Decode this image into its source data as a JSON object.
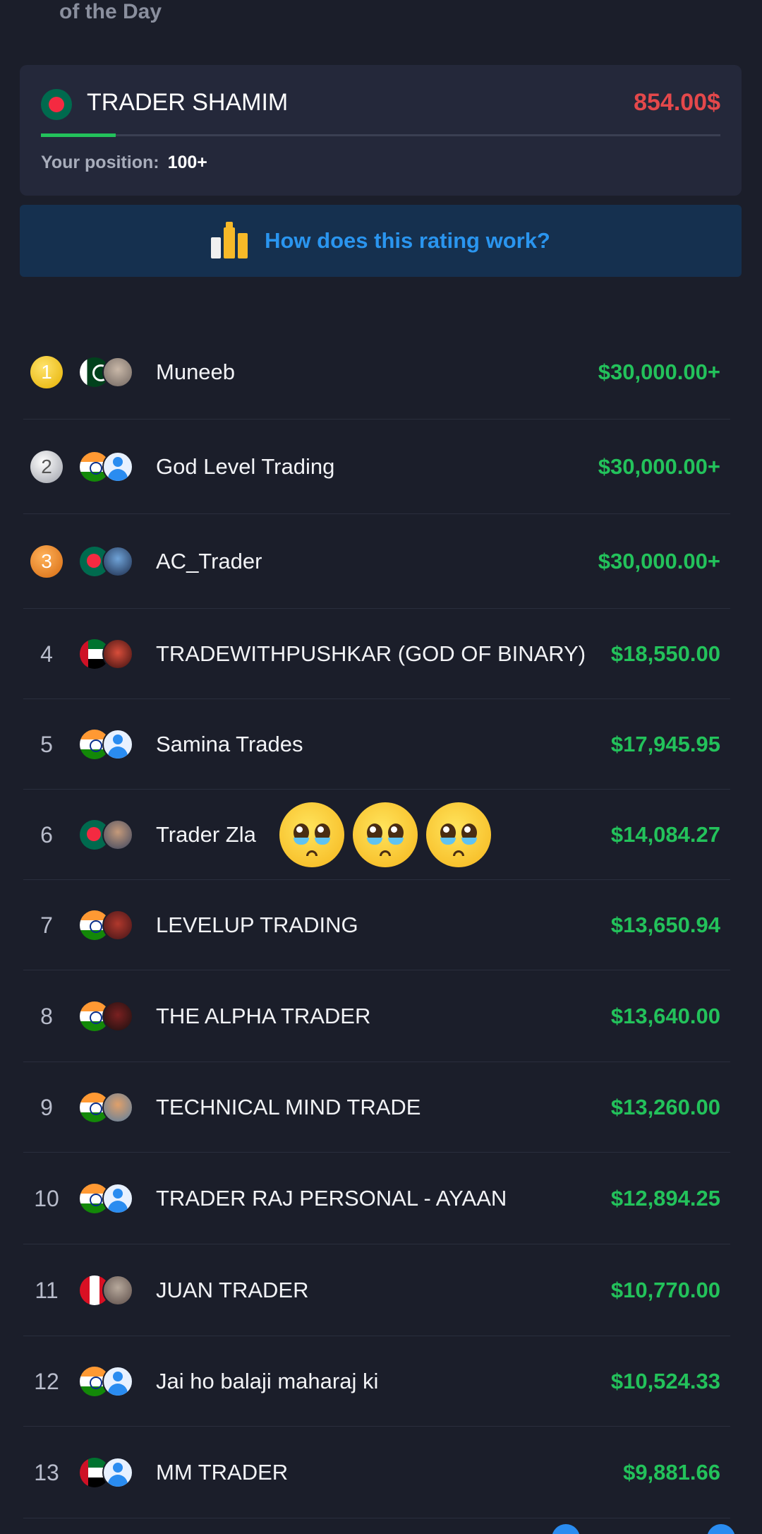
{
  "header": {
    "title_partial": "of the Day"
  },
  "my_card": {
    "name": "TRADER SHAMIM",
    "amount": "854.00$",
    "position_label": "Your position:",
    "position_value": "100+",
    "progress": 0.11
  },
  "info_banner": {
    "text": "How does this rating work?",
    "icon": "bar-chart-icon"
  },
  "leaderboard": [
    {
      "rank": "1",
      "medal": "gold",
      "flag": "pk",
      "name": "Muneeb",
      "amount": "$30,000.00+"
    },
    {
      "rank": "2",
      "medal": "silver",
      "flag": "in",
      "name": "God Level Trading",
      "amount": "$30,000.00+"
    },
    {
      "rank": "3",
      "medal": "bronze",
      "flag": "bd",
      "name": "AC_Trader",
      "amount": "$30,000.00+"
    },
    {
      "rank": "4",
      "flag": "ae",
      "name": "TRADEWITHPUSHKAR (GOD OF BINARY)",
      "amount": "$18,550.00"
    },
    {
      "rank": "5",
      "flag": "in",
      "name": "Samina Trades",
      "amount": "$17,945.95"
    },
    {
      "rank": "6",
      "flag": "bd",
      "name": "Trader Zla",
      "amount": "$14,084.27"
    },
    {
      "rank": "7",
      "flag": "in",
      "name": "LEVELUP TRADING",
      "amount": "$13,650.94"
    },
    {
      "rank": "8",
      "flag": "in",
      "name": "THE ALPHA TRADER",
      "amount": "$13,640.00"
    },
    {
      "rank": "9",
      "flag": "in",
      "name": "TECHNICAL MIND TRADE",
      "amount": "$13,260.00"
    },
    {
      "rank": "10",
      "flag": "in",
      "name": "TRADER RAJ PERSONAL - AYAAN",
      "amount": "$12,894.25"
    },
    {
      "rank": "11",
      "flag": "pe",
      "name": "JUAN TRADER",
      "amount": "$10,770.00"
    },
    {
      "rank": "12",
      "flag": "in",
      "name": "Jai ho balaji maharaj ki",
      "amount": "$10,524.33"
    },
    {
      "rank": "13",
      "flag": "ae",
      "name": "MM TRADER",
      "amount": "$9,881.66"
    }
  ],
  "overlay": {
    "emoji": "pleading-face-emoji",
    "count": 3
  },
  "colors": {
    "background": "#1b1e2a",
    "card": "#24283a",
    "positive": "#23c25b",
    "negative": "#e4484b",
    "link": "#2a95ef"
  }
}
